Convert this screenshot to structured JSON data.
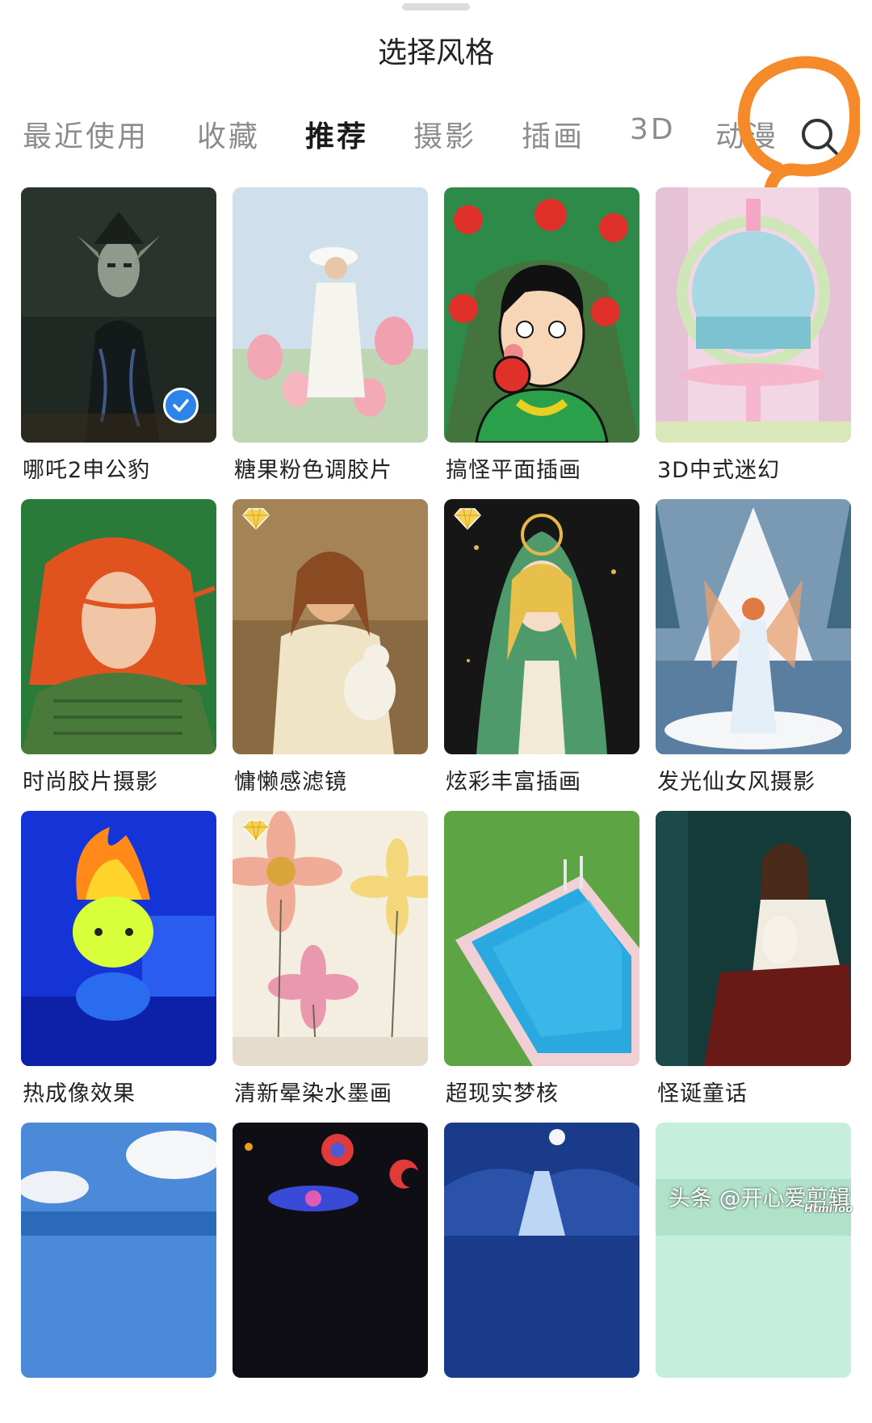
{
  "header": {
    "title": "选择风格"
  },
  "tabs": [
    {
      "label": "最近使用",
      "active": false
    },
    {
      "label": "收藏",
      "active": false
    },
    {
      "label": "推荐",
      "active": true
    },
    {
      "label": "摄影",
      "active": false
    },
    {
      "label": "插画",
      "active": false
    },
    {
      "label": "3D",
      "active": false
    },
    {
      "label": "动漫",
      "active": false
    }
  ],
  "search_icon": "search-icon",
  "colors": {
    "accent_check": "#2d84e8",
    "annotation": "#f58a2a",
    "tab_active": "#1a1a1a",
    "tab_inactive": "#8c8c8c"
  },
  "styles": [
    {
      "label": "哪吒2申公豹",
      "selected": true
    },
    {
      "label": "糖果粉色调胶片"
    },
    {
      "label": "搞怪平面插画"
    },
    {
      "label": "3D中式迷幻"
    },
    {
      "label": "时尚胶片摄影"
    },
    {
      "label": "慵懒感滤镜",
      "premium": true
    },
    {
      "label": "炫彩丰富插画",
      "premium": true
    },
    {
      "label": "发光仙女风摄影"
    },
    {
      "label": "热成像效果"
    },
    {
      "label": "清新晕染水墨画",
      "premium": true
    },
    {
      "label": "超现实梦核"
    },
    {
      "label": "怪诞童话"
    },
    {
      "label": ""
    },
    {
      "label": ""
    },
    {
      "label": ""
    },
    {
      "label": ""
    }
  ],
  "watermark": {
    "text": "头条 @开心爱剪辑",
    "sub": "HtmiToo"
  }
}
